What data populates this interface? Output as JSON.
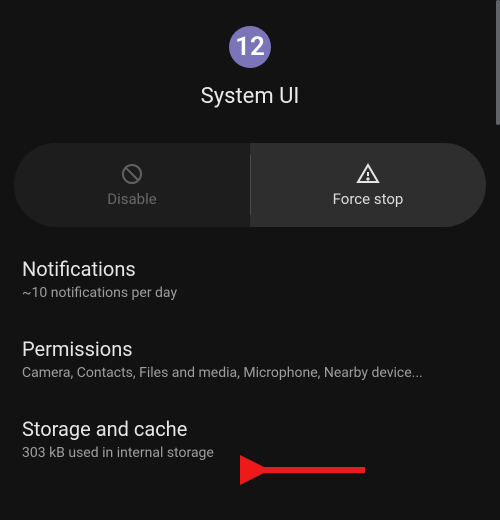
{
  "header": {
    "app_icon_text": "12",
    "app_name": "System UI"
  },
  "actions": {
    "disable": {
      "label": "Disable"
    },
    "force_stop": {
      "label": "Force stop"
    }
  },
  "settings": {
    "notifications": {
      "title": "Notifications",
      "subtitle": "~10 notifications per day"
    },
    "permissions": {
      "title": "Permissions",
      "subtitle": "Camera, Contacts, Files and media, Microphone, Nearby device..."
    },
    "storage": {
      "title": "Storage and cache",
      "subtitle": "303 kB used in internal storage"
    }
  }
}
